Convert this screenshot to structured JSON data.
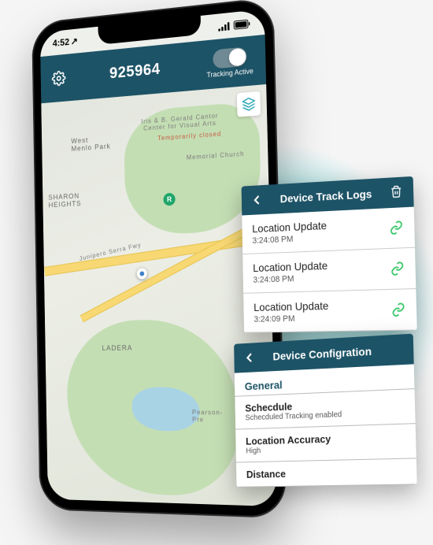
{
  "status_bar": {
    "time": "4:52"
  },
  "header": {
    "device_id": "925964",
    "toggle_label": "Tracking Active"
  },
  "map": {
    "labels": {
      "west_menlo": "West\nMenlo Park",
      "sharon": "SHARON\nHEIGHTS",
      "ladera": "LADERA",
      "cantor": "Iris & B. Gerald Cantor\nCenter for Visual Arts",
      "cantor_status": "Temporarily closed",
      "memorial": "Memorial Church",
      "pearson": "Pearson-\nPre",
      "junipero": "Junipero Serra Fwy"
    }
  },
  "logs_card": {
    "title": "Device Track Logs",
    "rows": [
      {
        "title": "Location Update",
        "time": "3:24:08 PM"
      },
      {
        "title": "Location Update",
        "time": "3:24:08 PM"
      },
      {
        "title": "Location Update",
        "time": "3:24:09 PM"
      }
    ]
  },
  "config_card": {
    "title": "Device Configration",
    "section": "General",
    "rows": [
      {
        "label": "Schecdule",
        "value": "Schecduled Tracking enabled"
      },
      {
        "label": "Location Accuracy",
        "value": "High"
      },
      {
        "label": "Distance",
        "value": ""
      }
    ]
  }
}
